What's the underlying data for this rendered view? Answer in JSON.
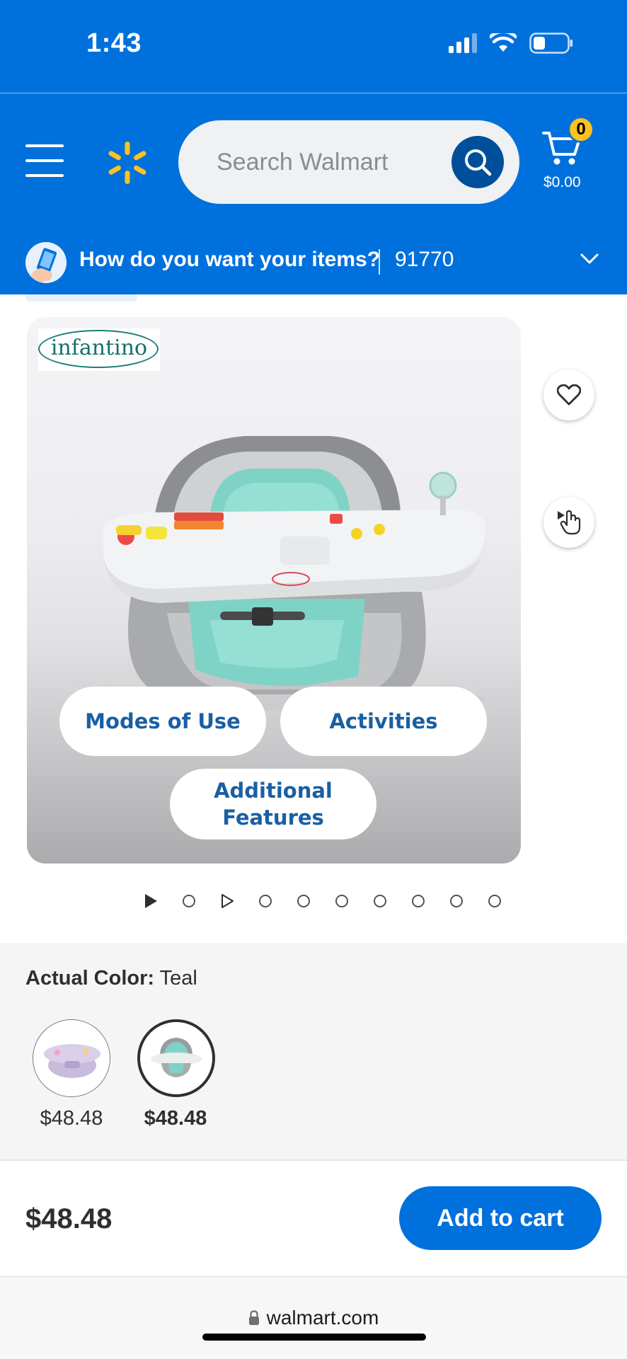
{
  "status_bar": {
    "time": "1:43"
  },
  "header": {
    "search_placeholder": "Search Walmart",
    "cart_count": "0",
    "cart_total": "$0.00"
  },
  "delivery": {
    "prompt": "How do you want your items?",
    "zip": "91770"
  },
  "gallery": {
    "brand": "infantino",
    "buttons": [
      "Modes of Use",
      "Activities",
      "Additional Features"
    ],
    "slide_count": 10
  },
  "variants": {
    "label": "Actual Color:",
    "selected_value": "Teal",
    "options": [
      {
        "price": "$48.48",
        "selected": false
      },
      {
        "price": "$48.48",
        "selected": true
      }
    ]
  },
  "bottom_bar": {
    "price": "$48.48",
    "add_to_cart_label": "Add to cart"
  },
  "browser": {
    "url": "walmart.com"
  },
  "colors": {
    "brand_blue": "#0071dc",
    "dark_blue": "#004f9a",
    "spark_yellow": "#ffc220",
    "pill_text": "#1a5fa3"
  }
}
